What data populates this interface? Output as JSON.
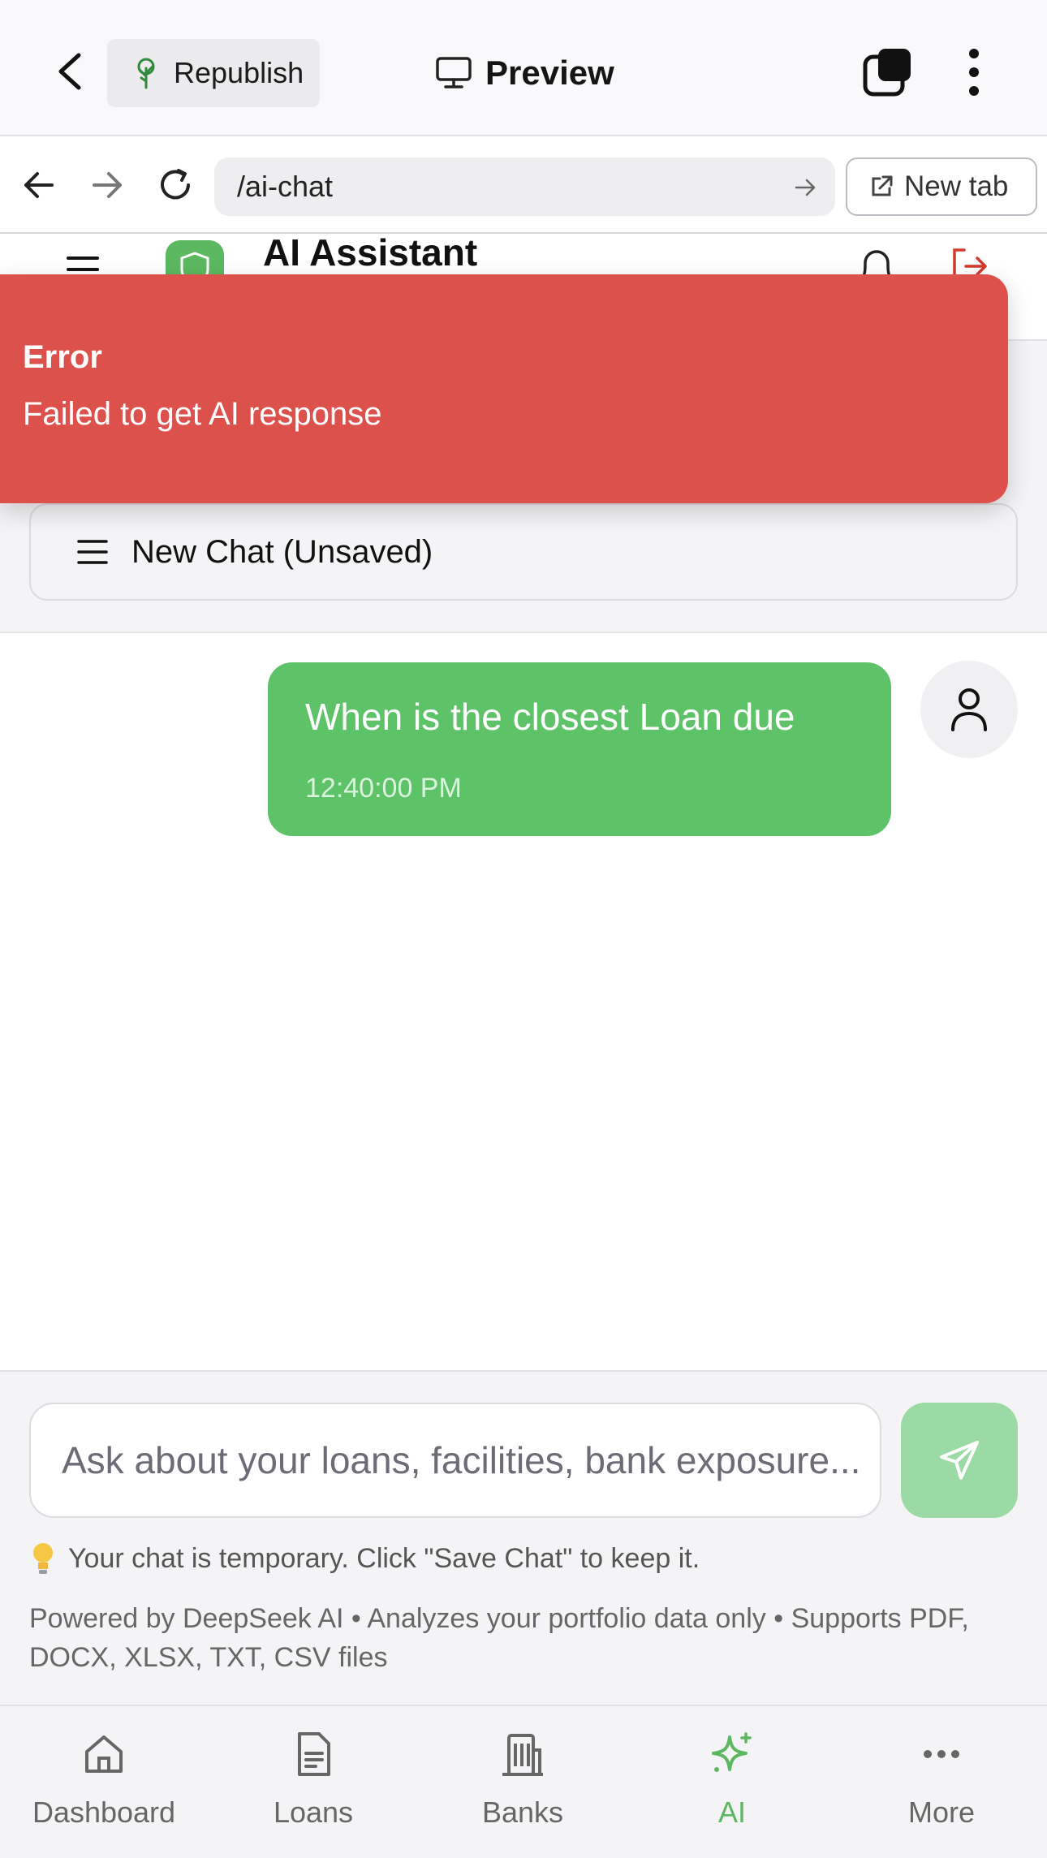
{
  "appbar": {
    "republish_label": "Republish",
    "preview_label": "Preview"
  },
  "browser": {
    "url": "/ai-chat",
    "new_tab_label": "New tab"
  },
  "app": {
    "title": "AI Assistant"
  },
  "toast": {
    "title": "Error",
    "message": "Failed to get AI response",
    "color": "#dd514c"
  },
  "chat_selector": {
    "label": "New Chat (Unsaved)"
  },
  "messages": [
    {
      "role": "user",
      "text": "When is the closest Loan due",
      "time": "12:40:00 PM"
    }
  ],
  "composer": {
    "placeholder": "Ask about your loans, facilities, bank exposure...",
    "hint": "Your chat is temporary. Click \"Save Chat\" to keep it.",
    "powered_by": "Powered by DeepSeek AI • Analyzes your portfolio data only • Supports PDF, DOCX, XLSX, TXT, CSV files"
  },
  "bottom_nav": {
    "items": [
      {
        "label": "Dashboard",
        "icon": "home-icon",
        "active": false
      },
      {
        "label": "Loans",
        "icon": "document-icon",
        "active": false
      },
      {
        "label": "Banks",
        "icon": "building-icon",
        "active": false
      },
      {
        "label": "AI",
        "icon": "sparkles-icon",
        "active": true
      },
      {
        "label": "More",
        "icon": "more-icon",
        "active": false
      }
    ]
  },
  "colors": {
    "accent": "#5cb860",
    "bubble": "#5dc268",
    "send_disabled": "#9bdaa4"
  }
}
